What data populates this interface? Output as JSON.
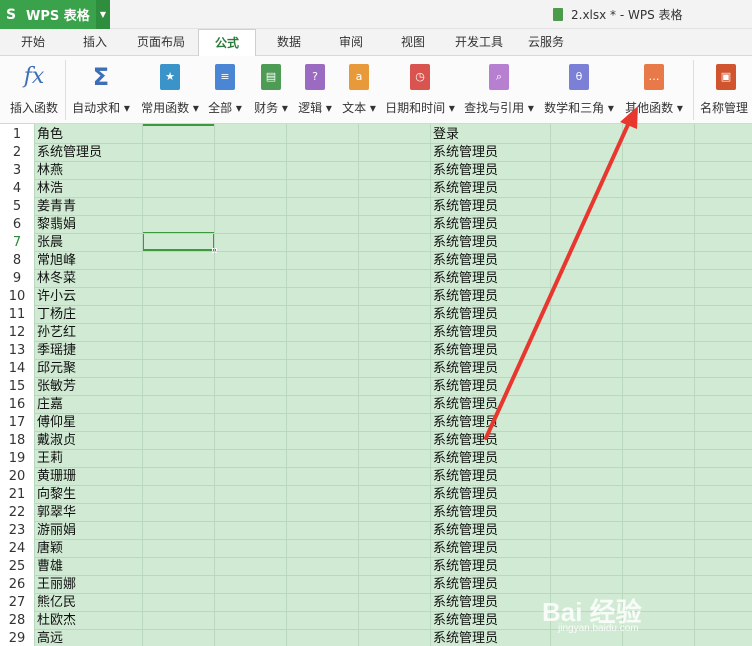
{
  "titlebar": {
    "app_name": "WPS 表格",
    "window_title": "2.xlsx * - WPS 表格"
  },
  "tabs": [
    {
      "label": "开始"
    },
    {
      "label": "插入"
    },
    {
      "label": "页面布局"
    },
    {
      "label": "公式"
    },
    {
      "label": "数据"
    },
    {
      "label": "审阅"
    },
    {
      "label": "视图"
    },
    {
      "label": "开发工具"
    },
    {
      "label": "云服务"
    }
  ],
  "active_tab": "公式",
  "ribbon": {
    "items": [
      {
        "label": "插入函数",
        "icon": "fx-icon",
        "color": "#3d6fb6"
      },
      {
        "label": "自动求和 ▾",
        "icon": "sigma-icon",
        "color": "#3d6fb6"
      },
      {
        "label": "常用函数 ▾",
        "icon": "star-book-icon",
        "color": "#3a93c9"
      },
      {
        "label": "全部 ▾",
        "icon": "list-book-icon",
        "color": "#4a86d4"
      },
      {
        "label": "财务 ▾",
        "icon": "finance-book-icon",
        "color": "#4d9b54"
      },
      {
        "label": "逻辑 ▾",
        "icon": "question-book-icon",
        "color": "#9b6bc2"
      },
      {
        "label": "文本 ▾",
        "icon": "text-book-icon",
        "color": "#e8993a"
      },
      {
        "label": "日期和时间 ▾",
        "icon": "clock-book-icon",
        "color": "#d9534f"
      },
      {
        "label": "查找与引用 ▾",
        "icon": "search-book-icon",
        "color": "#b67fd0"
      },
      {
        "label": "数学和三角 ▾",
        "icon": "theta-book-icon",
        "color": "#7b7fd6"
      },
      {
        "label": "其他函数 ▾",
        "icon": "more-book-icon",
        "color": "#e87a4a"
      },
      {
        "label": "名称管理",
        "icon": "name-manager-icon",
        "color": "#d0552f"
      }
    ]
  },
  "sheet": {
    "row_numbers": [
      "1",
      "2",
      "3",
      "4",
      "5",
      "6",
      "7",
      "8",
      "9",
      "10",
      "11",
      "12",
      "13",
      "14",
      "15",
      "16",
      "17",
      "18",
      "19",
      "20",
      "21",
      "22",
      "23",
      "24",
      "25",
      "26",
      "27",
      "28",
      "29"
    ],
    "column_a": [
      "角色",
      "系统管理员",
      "林燕",
      "林浩",
      "姜青青",
      "黎翡娟",
      "张晨",
      "常旭峰",
      "林冬菜",
      "许小云",
      "丁杨庄",
      "孙艺红",
      "季瑶捷",
      "邱元聚",
      "张敏芳",
      "庄嘉",
      "傅仰星",
      "戴淑贞",
      "王莉",
      "黄珊珊",
      "向黎生",
      "郭翠华",
      "游丽娟",
      "唐颖",
      "曹雄",
      "王丽娜",
      "熊亿民",
      "杜欧杰",
      "高远"
    ],
    "column_f": [
      "登录",
      "系统管理员",
      "系统管理员",
      "系统管理员",
      "系统管理员",
      "系统管理员",
      "系统管理员",
      "系统管理员",
      "系统管理员",
      "系统管理员",
      "系统管理员",
      "系统管理员",
      "系统管理员",
      "系统管理员",
      "系统管理员",
      "系统管理员",
      "系统管理员",
      "系统管理员",
      "系统管理员",
      "系统管理员",
      "系统管理员",
      "系统管理员",
      "系统管理员",
      "系统管理员",
      "系统管理员",
      "系统管理员",
      "系统管理员",
      "系统管理员",
      "系统管理员"
    ],
    "selected_row": "7"
  },
  "watermark": {
    "main": "Bai 经验",
    "sub": "jingyan.baidu.com"
  },
  "colors": {
    "accent": "#3aa24a",
    "grid_bg": "#d0ead3",
    "arrow": "#e8372e"
  }
}
